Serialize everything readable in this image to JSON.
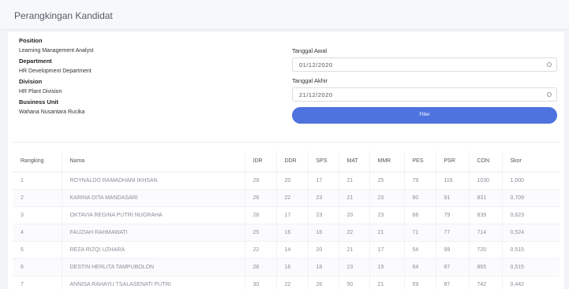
{
  "page": {
    "title": "Perangkingan Kandidat"
  },
  "info": {
    "position_label": "Position",
    "position_value": "Learning Management Analyst",
    "department_label": "Department",
    "department_value": "HR Development Department",
    "division_label": "Division",
    "division_value": "HR Plant Division",
    "business_unit_label": "Business Unit",
    "business_unit_value": "Wahana Nusantara Rucika"
  },
  "filter": {
    "start_label": "Tanggal Awal",
    "start_value": "01/12/2020",
    "end_label": "Tanggal Akhir",
    "end_value": "21/12/2020",
    "button_label": "Filter",
    "button_color": "#4e73df"
  },
  "table": {
    "headers": [
      "Rangking",
      "Nama",
      "IDR",
      "DDR",
      "SPS",
      "MAT",
      "MMR",
      "PES",
      "PSR",
      "CON",
      "Skor"
    ],
    "rows": [
      [
        "1",
        "ROYNALDO RAMADHANI IKHSAN",
        "29",
        "20",
        "17",
        "21",
        "25",
        "79",
        "116",
        "1030",
        "1,000"
      ],
      [
        "2",
        "KARINA DITA MANDASARI",
        "26",
        "22",
        "23",
        "21",
        "23",
        "80",
        "91",
        "831",
        "0,709"
      ],
      [
        "3",
        "OKTAVIA REGINA PUTRI NUGRAHA",
        "28",
        "17",
        "23",
        "20",
        "23",
        "68",
        "79",
        "839",
        "0,623"
      ],
      [
        "4",
        "FAUZIAH RAHMAWATI",
        "25",
        "16",
        "16",
        "22",
        "21",
        "71",
        "77",
        "714",
        "0,524"
      ],
      [
        "5",
        "REZA RIZQI UZHARA",
        "22",
        "14",
        "20",
        "21",
        "17",
        "54",
        "99",
        "720",
        "0,515"
      ],
      [
        "6",
        "DESTIN HERLITA TAMPUBOLON",
        "28",
        "16",
        "18",
        "23",
        "19",
        "64",
        "87",
        "865",
        "0,515"
      ],
      [
        "7",
        "ANNISA RAHAYU TSALASENATI PUTRI",
        "30",
        "22",
        "26",
        "50",
        "21",
        "59",
        "87",
        "742",
        "0,442"
      ]
    ]
  }
}
